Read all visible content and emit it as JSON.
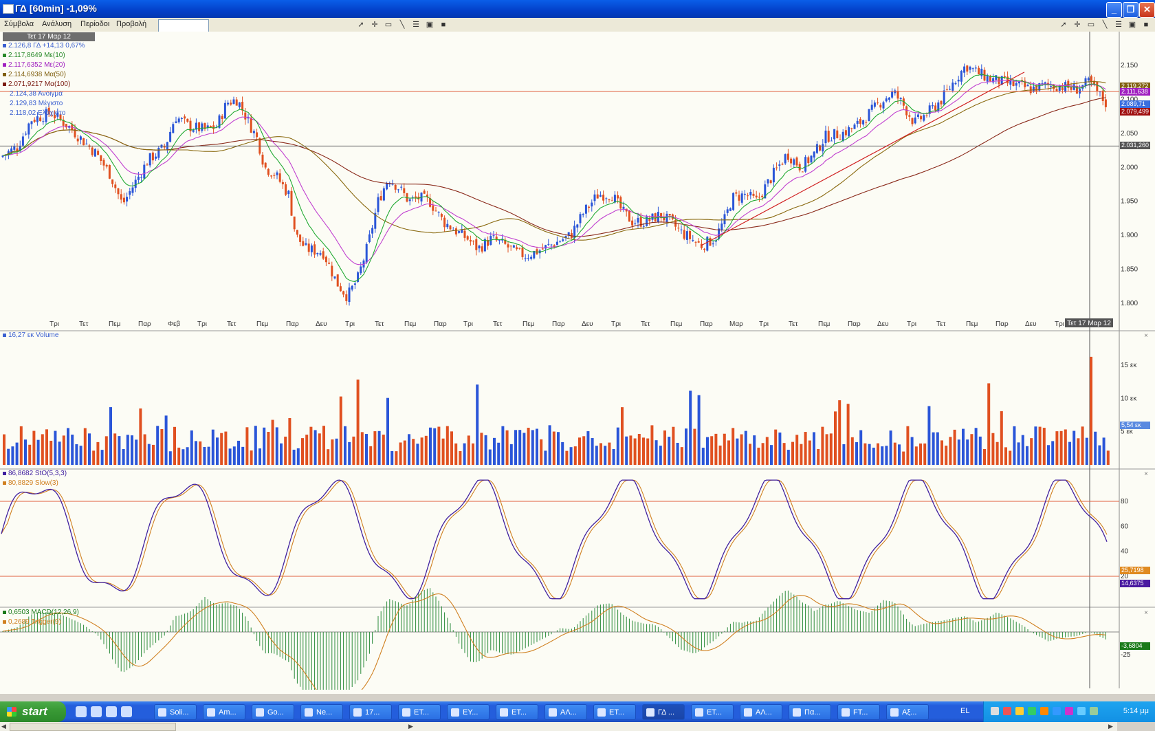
{
  "window": {
    "title": "ΓΔ [60min] -1,09%",
    "controls": {
      "minimize": "_",
      "maximize": "❐",
      "close": "✕"
    }
  },
  "menu": {
    "items": [
      "Σύμβολα",
      "Ανάλυση",
      "Περίοδοι",
      "Προβολή"
    ],
    "symbol_input": ""
  },
  "price_panel": {
    "date_label": "Τετ 17 Μαρ 12",
    "legend": [
      {
        "text": "2.126,8 ΓΔ +14,13 0,67%",
        "color": "#3a5fd0"
      },
      {
        "text": "2.117,8649 Με(10)",
        "color": "#2a8a2a"
      },
      {
        "text": "2.117,6352 Με(20)",
        "color": "#a020c0"
      },
      {
        "text": "2.114,6938 Μα(50)",
        "color": "#806010"
      },
      {
        "text": "2.071,9217 Μα(100)",
        "color": "#7a1a10"
      },
      {
        "text": "2.124,38 Άνοιγμα",
        "color": "#3a5fd0"
      },
      {
        "text": "2.129,83 Μέγιστο",
        "color": "#3a5fd0"
      },
      {
        "text": "2.118,02 Ελάχιστο",
        "color": "#3a5fd0"
      }
    ],
    "y_ticks": [
      "2.150",
      "2.100",
      "2.050",
      "2.000",
      "1.950",
      "1.900",
      "1.850",
      "1.800"
    ],
    "value_labels": [
      {
        "text": "2.119,272",
        "color": "#806010"
      },
      {
        "text": "2.111,638",
        "color": "#a020c0"
      },
      {
        "text": "2.031,260",
        "color": "#555555"
      },
      {
        "text": "2.089,71",
        "color": "#3a6fe0"
      },
      {
        "text": "2.079,499",
        "color": "#a01010"
      }
    ],
    "x_ticks": [
      "Τρι",
      "Τετ",
      "Πεμ",
      "Παρ",
      "Φεβ",
      "Τρι",
      "Τετ",
      "Πεμ",
      "Παρ",
      "Δευ",
      "Τρι",
      "Τετ",
      "Πεμ",
      "Παρ",
      "Τρι",
      "Τετ",
      "Πεμ",
      "Παρ",
      "Δευ",
      "Τρι",
      "Τετ",
      "Πεμ",
      "Παρ",
      "Μαρ",
      "Τρι",
      "Τετ",
      "Πεμ",
      "Παρ",
      "Δευ",
      "Τρι",
      "Τετ",
      "Πεμ",
      "Παρ",
      "Δευ",
      "Τρι"
    ],
    "cursor_date": "Τετ 17 Μαρ 12",
    "hlines": {
      "resistance": 2111.6,
      "support": 2031.26
    }
  },
  "volume_panel": {
    "legend": "16,27 εκ Volume",
    "y_ticks": [
      "15 εκ",
      "10 εκ",
      "5 εκ"
    ],
    "value_label": "5,54 εκ",
    "spike": 16.27
  },
  "stochastic_panel": {
    "legend": [
      {
        "text": "86,8682 StO(5,3,3)",
        "color": "#4020a0"
      },
      {
        "text": "80,8829 Slow(3)",
        "color": "#d08020"
      }
    ],
    "y_ticks": [
      "80",
      "60",
      "40",
      "20"
    ],
    "value_labels": [
      {
        "text": "25,7198",
        "color": "#e08a20"
      },
      {
        "text": "14,6375",
        "color": "#4a1aa0"
      }
    ],
    "overbought": 80,
    "oversold": 20
  },
  "macd_panel": {
    "legend": [
      {
        "text": "0,6503 MACD(12,26,9)",
        "color": "#1a7a1a"
      },
      {
        "text": "0,2689 Trigger(9)",
        "color": "#d08020"
      }
    ],
    "y_ticks": [
      "-25"
    ],
    "value_labels": [
      {
        "text": "-3,6804",
        "color": "#1a7a1a"
      }
    ]
  },
  "taskbar": {
    "start_label": "start",
    "tasks": [
      "Soli...",
      "Am...",
      "Go...",
      "Ne...",
      "17...",
      "ET...",
      "EY...",
      "ET...",
      "ΑΛ...",
      "ET...",
      "ΓΔ ...",
      "ET...",
      "ΑΛ...",
      "Πα...",
      "FT...",
      "Αξ..."
    ],
    "active_task_index": 10,
    "language": "EL",
    "clock": "5:14 μμ"
  },
  "colors": {
    "up_candle": "#2a55d8",
    "down_candle": "#e05020",
    "ema10": "#22aa33",
    "ema20": "#c040d0",
    "ma50": "#8a6a10",
    "ma100": "#8a2a1a"
  }
}
